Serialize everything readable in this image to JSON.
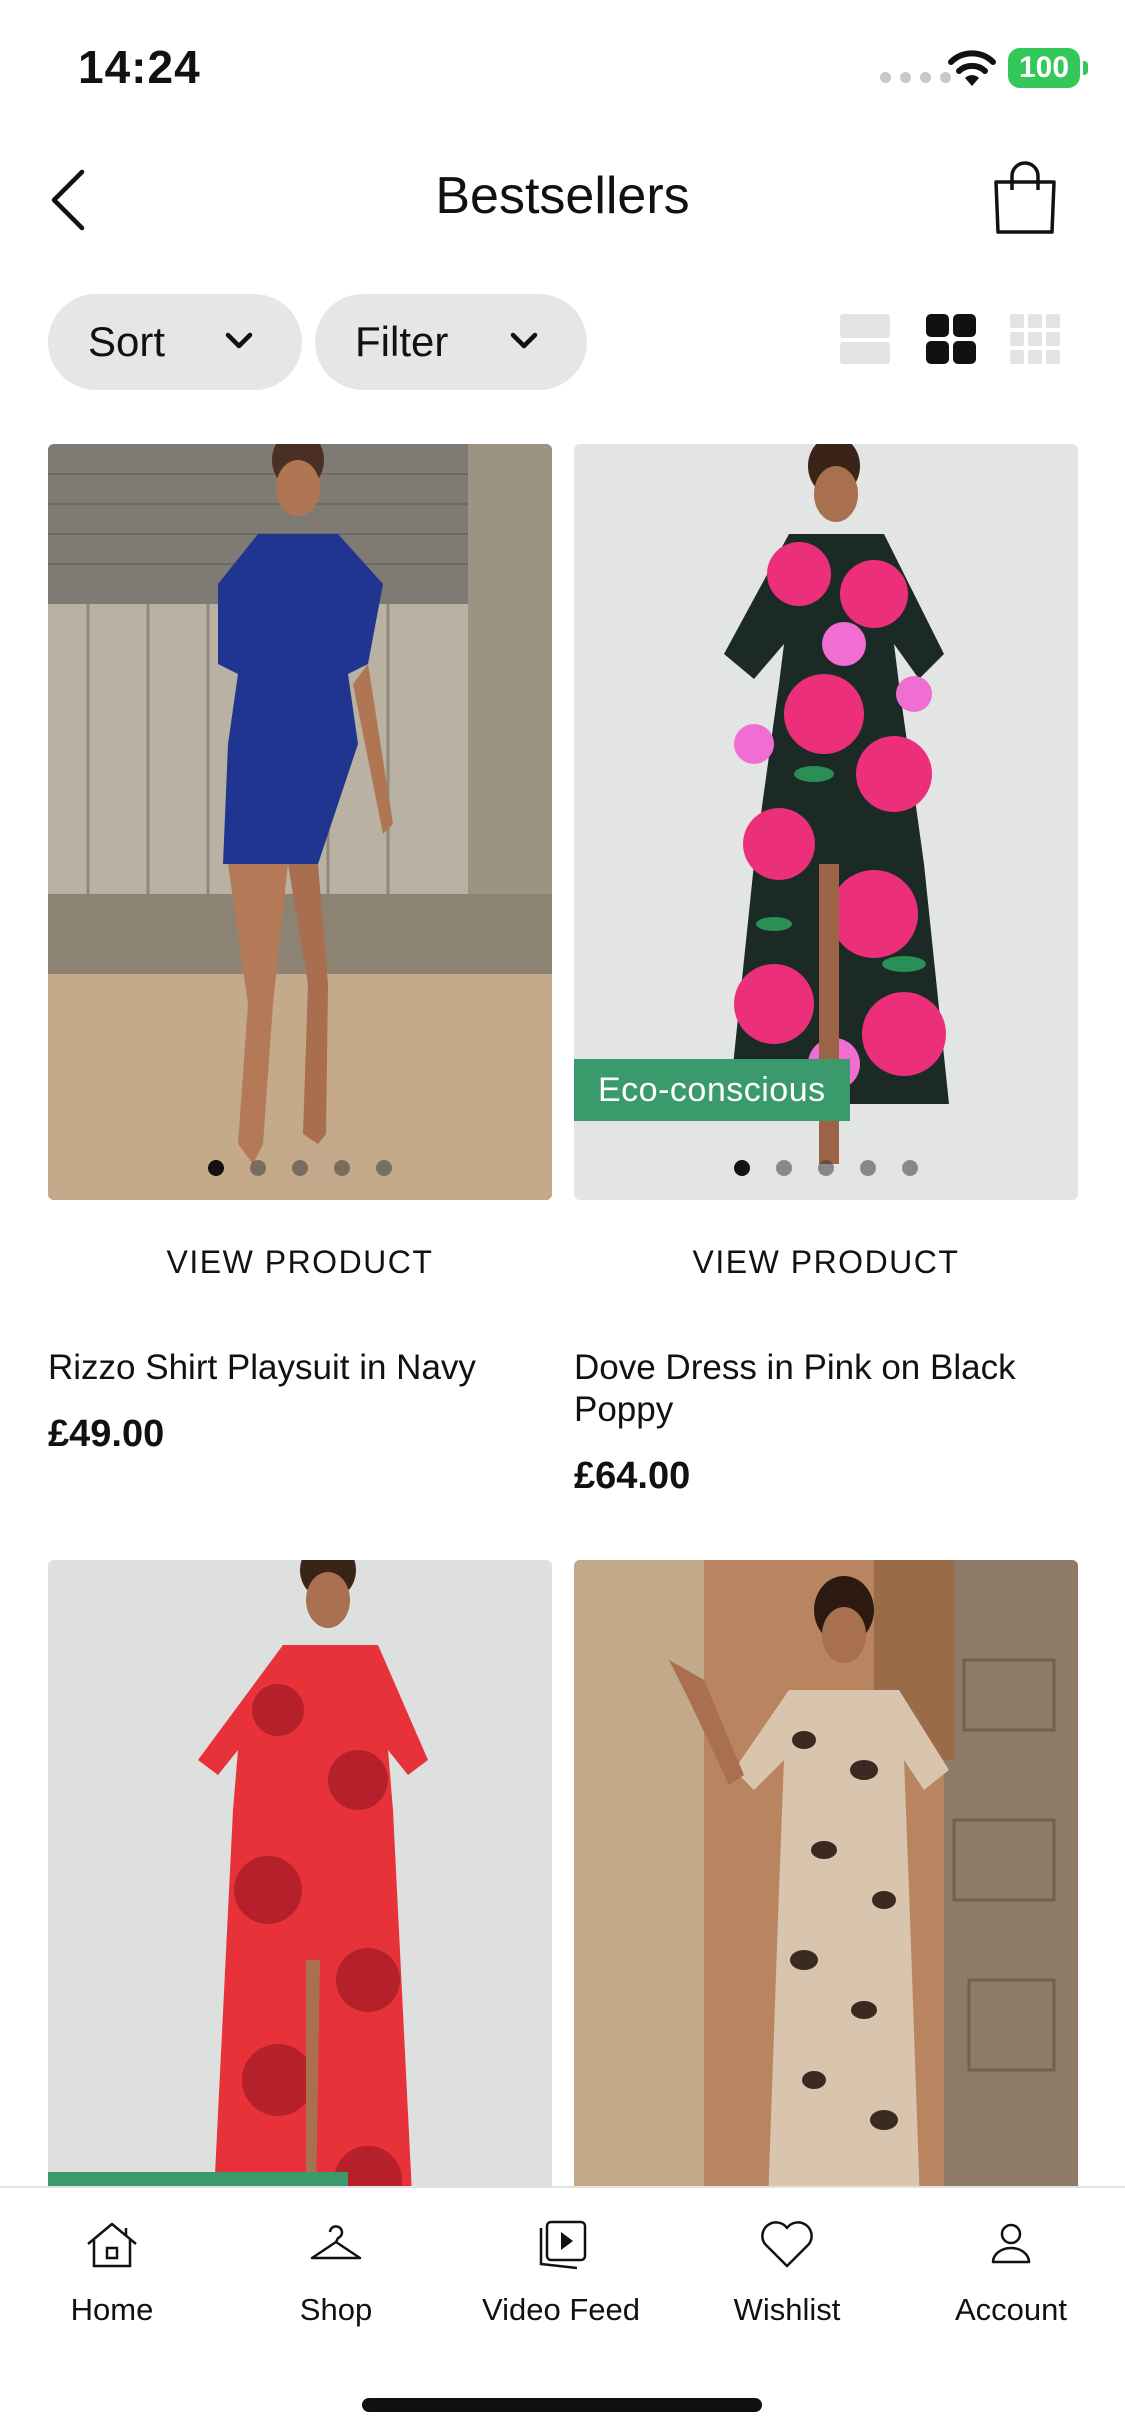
{
  "status_bar": {
    "time": "14:24",
    "battery": "100",
    "icons": [
      "signal-dots-icon",
      "wifi-icon",
      "battery-icon"
    ],
    "battery_color": "#34c759"
  },
  "header": {
    "title": "Bestsellers",
    "back_icon": "chevron-left-icon",
    "bag_icon": "shopping-bag-icon"
  },
  "toolbar": {
    "sort_label": "Sort",
    "filter_label": "Filter",
    "view_modes": [
      "single-column",
      "two-column",
      "three-column"
    ],
    "active_view": "two-column"
  },
  "products": [
    {
      "name": "Rizzo Shirt Playsuit in Navy",
      "price": "£49.00",
      "cta": "VIEW PRODUCT",
      "badge": "",
      "image_count": 5,
      "active_image": 1
    },
    {
      "name": "Dove Dress in Pink on Black Poppy",
      "price": "£64.00",
      "cta": "VIEW PRODUCT",
      "badge": "Eco-conscious",
      "image_count": 5,
      "active_image": 1
    },
    {
      "name": "",
      "price": "",
      "cta": "",
      "badge": "",
      "image_count": 0
    },
    {
      "name": "",
      "price": "",
      "cta": "",
      "badge": "",
      "image_count": 0
    }
  ],
  "colors": {
    "accent_green": "#3b9a6b",
    "pill_bg": "#e6e6e6",
    "text": "#111111"
  },
  "bottom_nav": {
    "items": [
      {
        "label": "Home",
        "icon": "home-icon"
      },
      {
        "label": "Shop",
        "icon": "hanger-icon"
      },
      {
        "label": "Video Feed",
        "icon": "video-feed-icon"
      },
      {
        "label": "Wishlist",
        "icon": "heart-icon"
      },
      {
        "label": "Account",
        "icon": "person-icon"
      }
    ]
  }
}
